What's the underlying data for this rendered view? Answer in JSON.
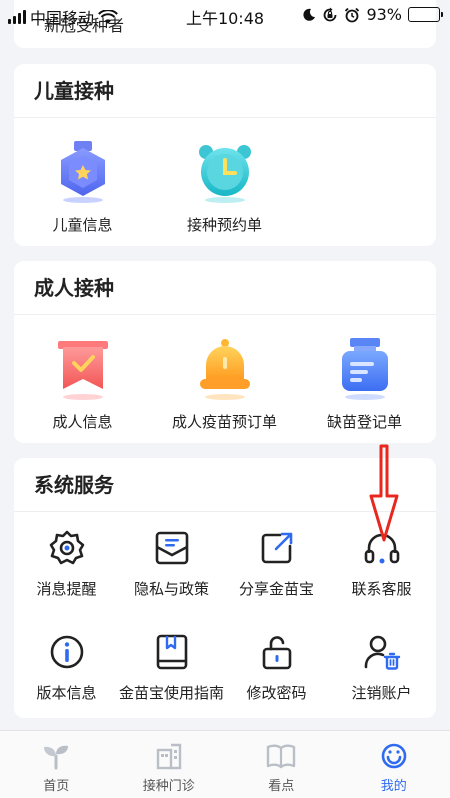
{
  "status_bar": {
    "carrier": "中国移动",
    "time": "上午10:48",
    "battery": "93%",
    "battery_level": 0.93
  },
  "top_card": {
    "name": "新冠受种者"
  },
  "children": {
    "title": "儿童接种",
    "items": [
      {
        "label": "儿童信息",
        "icon": "child-badge-icon"
      },
      {
        "label": "接种预约单",
        "icon": "alarm-clock-icon"
      }
    ]
  },
  "adult": {
    "title": "成人接种",
    "items": [
      {
        "label": "成人信息",
        "icon": "adult-ribbon-icon"
      },
      {
        "label": "成人疫苗预订单",
        "icon": "bell-icon"
      },
      {
        "label": "缺苗登记单",
        "icon": "vaccine-bottle-icon"
      }
    ]
  },
  "system": {
    "title": "系统服务",
    "items": [
      {
        "label": "消息提醒",
        "icon": "gear-icon"
      },
      {
        "label": "隐私与政策",
        "icon": "document-icon"
      },
      {
        "label": "分享金苗宝",
        "icon": "share-icon"
      },
      {
        "label": "联系客服",
        "icon": "headset-icon"
      },
      {
        "label": "版本信息",
        "icon": "info-icon"
      },
      {
        "label": "金苗宝使用指南",
        "icon": "guide-book-icon"
      },
      {
        "label": "修改密码",
        "icon": "unlock-icon"
      },
      {
        "label": "注销账户",
        "icon": "user-delete-icon"
      }
    ]
  },
  "tabbar": {
    "tabs": [
      {
        "label": "首页",
        "icon": "home-sprout-icon",
        "active": false
      },
      {
        "label": "接种门诊",
        "icon": "clinic-icon",
        "active": false
      },
      {
        "label": "看点",
        "icon": "book-icon",
        "active": false
      },
      {
        "label": "我的",
        "icon": "profile-icon",
        "active": true
      }
    ]
  },
  "colors": {
    "accent": "#2f6bf0",
    "annotation_arrow": "#e8281e",
    "background": "#f2f4f7"
  }
}
